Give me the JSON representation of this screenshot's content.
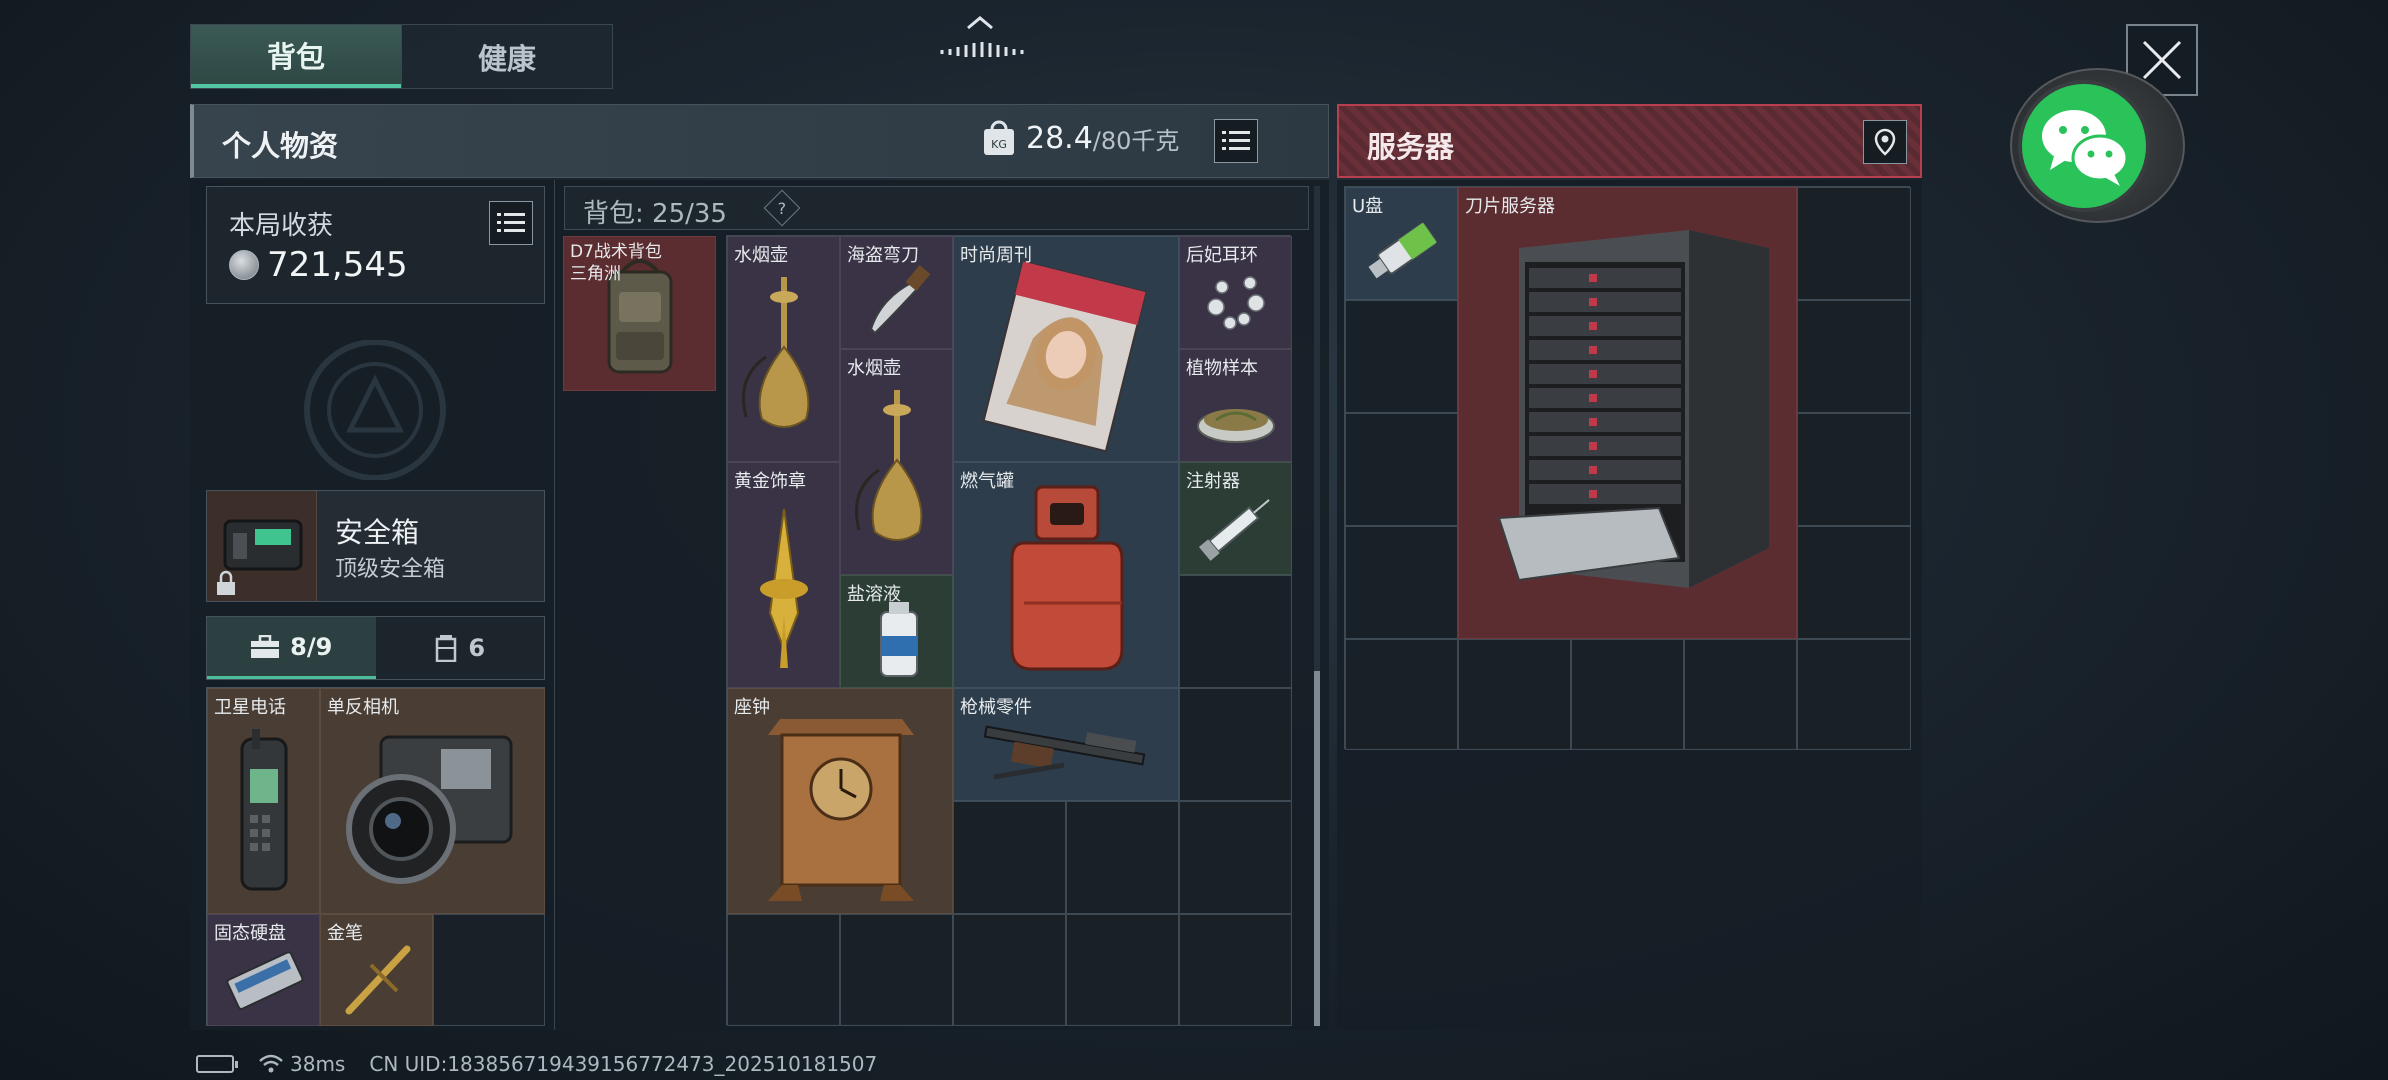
{
  "top_tabs": [
    {
      "label": "背包",
      "active": true
    },
    {
      "label": "健康",
      "active": false
    }
  ],
  "personal": {
    "title": "个人物资",
    "weight_current": "28.4",
    "weight_max": "/80千克",
    "weight_icon": "kg-weight-icon"
  },
  "loot": {
    "label": "本局收获",
    "value": "721,545"
  },
  "left_item": {
    "label": "D7战术背包\n三角洲"
  },
  "safe_box": {
    "title": "安全箱",
    "subtitle": "顶级安全箱"
  },
  "sub_tabs": [
    {
      "label": "8/9",
      "icon": "toolbox-icon",
      "active": true
    },
    {
      "label": "6",
      "icon": "canister-icon",
      "active": false
    }
  ],
  "pocket_items": [
    {
      "label": "卫星电话",
      "color": "brown"
    },
    {
      "label": "单反相机",
      "color": "brown"
    },
    {
      "label": "固态硬盘",
      "color": "purple"
    },
    {
      "label": "金笔",
      "color": "brown"
    }
  ],
  "backpack": {
    "header": "背包: 25/35",
    "help": "?",
    "items": [
      {
        "label": "水烟壶",
        "color": "purple"
      },
      {
        "label": "海盗弯刀",
        "color": "purple"
      },
      {
        "label": "时尚周刊",
        "color": "blue"
      },
      {
        "label": "后妃耳环",
        "color": "purple"
      },
      {
        "label": "水烟壶",
        "color": "purple"
      },
      {
        "label": "植物样本",
        "color": "purple"
      },
      {
        "label": "黄金饰章",
        "color": "purple"
      },
      {
        "label": "燃气罐",
        "color": "blue"
      },
      {
        "label": "注射器",
        "color": "green"
      },
      {
        "label": "盐溶液",
        "color": "green"
      },
      {
        "label": "座钟",
        "color": "brown"
      },
      {
        "label": "枪械零件",
        "color": "blue"
      }
    ]
  },
  "server": {
    "title": "服务器",
    "items": [
      {
        "label": "U盘",
        "color": "blue"
      },
      {
        "label": "刀片服务器",
        "color": "red"
      }
    ]
  },
  "status": {
    "ping": "38ms",
    "uid": "CN UID:183856719439156772473_202510181507"
  },
  "colors": {
    "accent_green": "#52c5a2",
    "danger_red": "#b8404e",
    "wechat_green": "#29c35a"
  }
}
